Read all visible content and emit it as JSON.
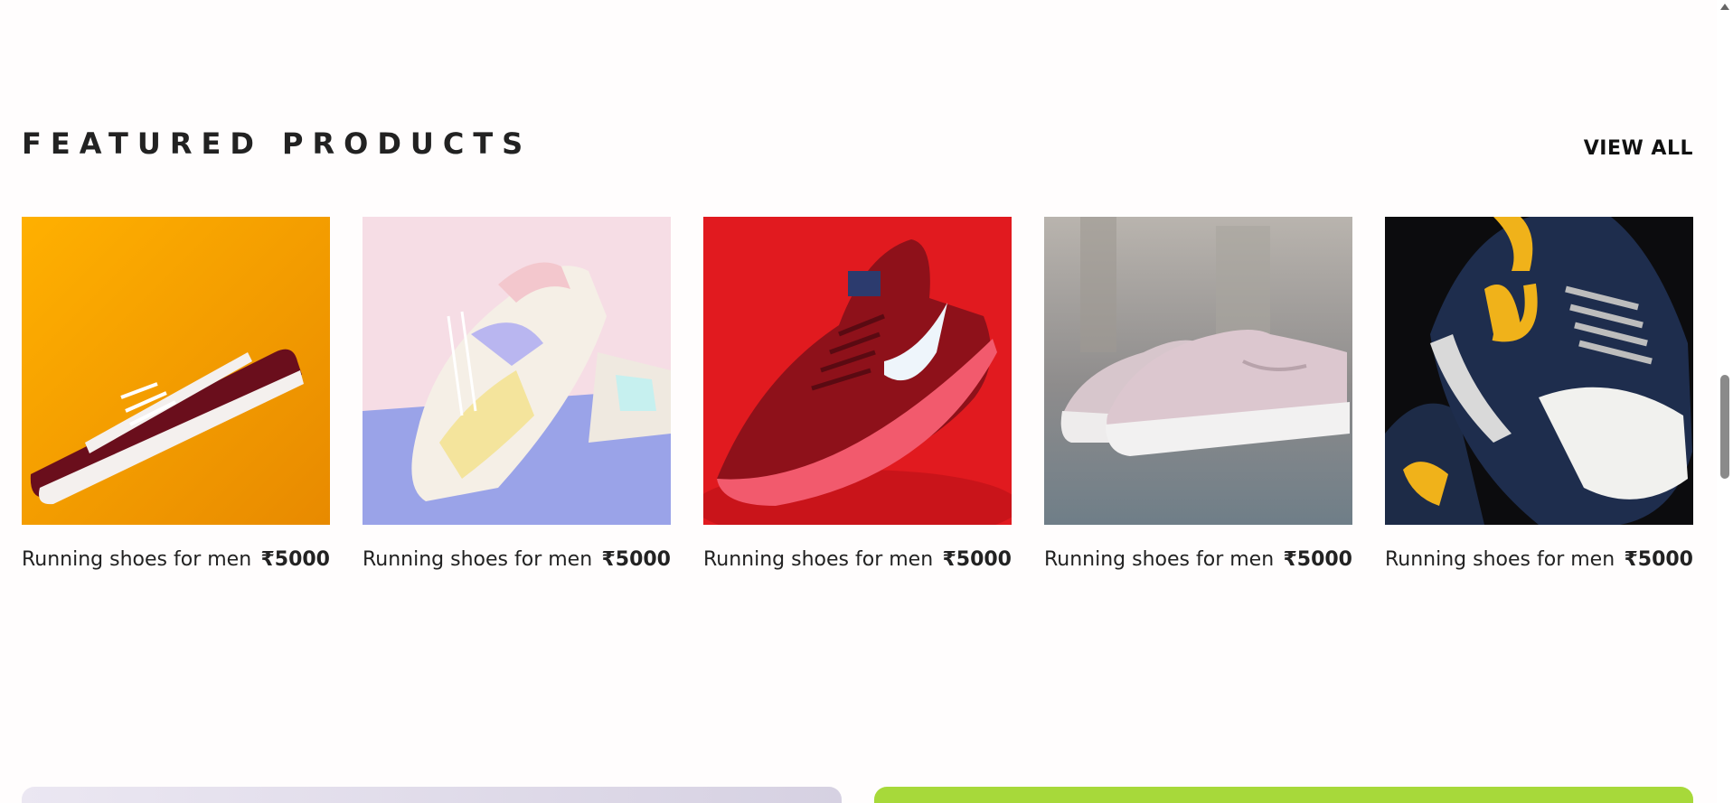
{
  "section": {
    "title": "FEATURED PRODUCTS",
    "view_all_label": "VIEW ALL"
  },
  "products": [
    {
      "name": "Running shoes for men",
      "price": "₹5000",
      "image": "maroon-skate-sneaker-on-orange"
    },
    {
      "name": "Running shoes for men",
      "price": "₹5000",
      "image": "pastel-sneaker-on-pink"
    },
    {
      "name": "Running shoes for men",
      "price": "₹5000",
      "image": "red-knit-running-shoe"
    },
    {
      "name": "Running shoes for men",
      "price": "₹5000",
      "image": "pink-platform-sneakers-street"
    },
    {
      "name": "Running shoes for men",
      "price": "₹5000",
      "image": "navy-yellow-air-sneaker"
    }
  ],
  "colors": {
    "promo_left": "#e4e0ee",
    "promo_right": "#a7d93a"
  }
}
